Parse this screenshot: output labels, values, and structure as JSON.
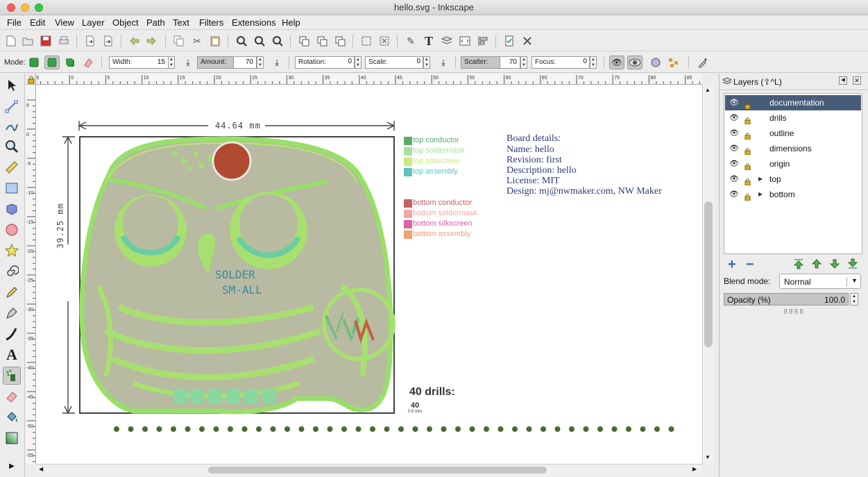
{
  "window": {
    "title": "hello.svg - Inkscape"
  },
  "menu": [
    "File",
    "Edit",
    "View",
    "Layer",
    "Object",
    "Path",
    "Text",
    "Filters",
    "Extensions",
    "Help"
  ],
  "controls": {
    "mode_label": "Mode:",
    "width_label": "Width:",
    "width_value": "15",
    "amount_label": "Amount:",
    "amount_value": "70",
    "rotation_label": "Rotation:",
    "rotation_value": "0",
    "scale_label": "Scale:",
    "scale_value": "0",
    "scatter_label": "Scatter:",
    "scatter_value": "70",
    "focus_label": "Focus:",
    "focus_value": "0"
  },
  "rulers": {
    "h_ticks": [
      "-5",
      "0",
      "5",
      "10",
      "15",
      "20",
      "25",
      "30",
      "35",
      "40",
      "45",
      "50",
      "55",
      "60",
      "65",
      "70",
      "75",
      "80",
      "85"
    ],
    "v_ticks": [
      "5",
      "0",
      "-5",
      "-10",
      "-15",
      "-20",
      "-25",
      "-30",
      "-35",
      "-40",
      "-45",
      "-50",
      "-55"
    ]
  },
  "drawing": {
    "dim_width": "44.64 mm",
    "dim_height": "39.25 mm",
    "center_text_1": "SOLDER",
    "center_text_2": "SM-ALL",
    "drills_title": "40 drills:",
    "drills_count": "40",
    "drills_size": "0.5 mm",
    "drill_dot_count": 40,
    "legend_top": [
      {
        "label": "top conductor",
        "color": "#5aab6a"
      },
      {
        "label": "top soldermask",
        "color": "#a8e0a0"
      },
      {
        "label": "top silkscreen",
        "color": "#c8ec80"
      },
      {
        "label": "top assembly",
        "color": "#58c4c0"
      }
    ],
    "legend_bottom": [
      {
        "label": "bottom conductor",
        "color": "#c86060"
      },
      {
        "label": "bottom soldermask",
        "color": "#f0a8a8"
      },
      {
        "label": "bottom silkscreen",
        "color": "#e060a0"
      },
      {
        "label": "bottom assembly",
        "color": "#f0a070"
      }
    ],
    "board_details": [
      "Board details:",
      "Name: hello",
      "Revision: first",
      "Description: hello",
      "License: MIT",
      "Design: mj@nwmaker.com, NW Maker"
    ]
  },
  "layers_panel": {
    "title": "Layers (⇧^L)",
    "layers": [
      {
        "name": "documentation",
        "selected": true,
        "expandable": false
      },
      {
        "name": "drills",
        "selected": false,
        "expandable": false
      },
      {
        "name": "outline",
        "selected": false,
        "expandable": false
      },
      {
        "name": "dimensions",
        "selected": false,
        "expandable": false
      },
      {
        "name": "origin",
        "selected": false,
        "expandable": false
      },
      {
        "name": "top",
        "selected": false,
        "expandable": true
      },
      {
        "name": "bottom",
        "selected": false,
        "expandable": true
      }
    ],
    "blend_label": "Blend mode:",
    "blend_value": "Normal",
    "opacity_label": "Opacity (%)",
    "opacity_value": "100.0"
  }
}
